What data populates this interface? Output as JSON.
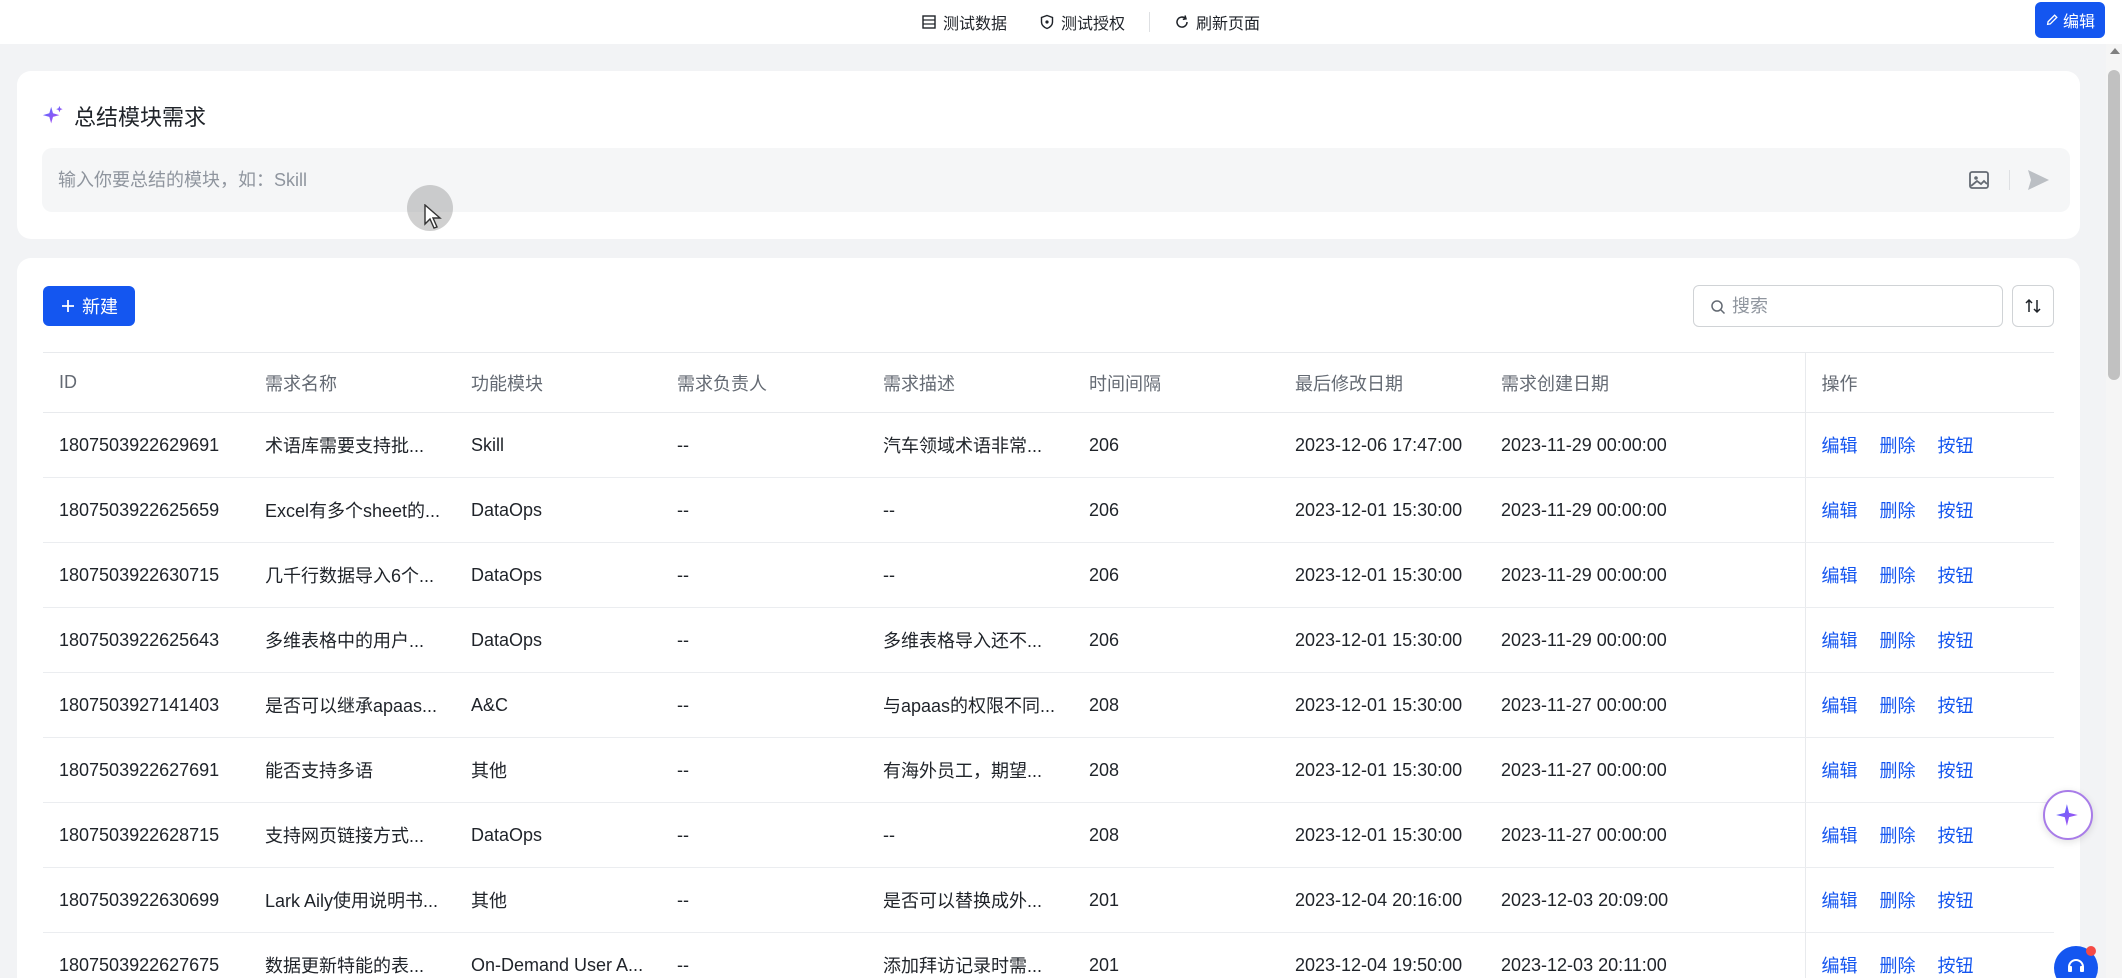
{
  "toolbar": {
    "test_data": "测试数据",
    "test_auth": "测试授权",
    "refresh": "刷新页面",
    "edit": "编辑"
  },
  "ai_summary": {
    "title": "总结模块需求",
    "placeholder": "输入你要总结的模块，如：Skill"
  },
  "table_toolbar": {
    "new_label": "新建",
    "search_placeholder": "搜索"
  },
  "columns": [
    "ID",
    "需求名称",
    "功能模块",
    "需求负责人",
    "需求描述",
    "时间间隔",
    "最后修改日期",
    "需求创建日期",
    "操作"
  ],
  "actions": {
    "edit": "编辑",
    "delete": "删除",
    "button": "按钮"
  },
  "rows": [
    {
      "id": "1807503922629691",
      "name": "术语库需要支持批...",
      "module": "Skill",
      "owner": "--",
      "desc": "汽车领域术语非常...",
      "interval": "206",
      "modified": "2023-12-06 17:47:00",
      "created": "2023-11-29 00:00:00"
    },
    {
      "id": "1807503922625659",
      "name": "Excel有多个sheet的...",
      "module": "DataOps",
      "owner": "--",
      "desc": "--",
      "interval": "206",
      "modified": "2023-12-01 15:30:00",
      "created": "2023-11-29 00:00:00"
    },
    {
      "id": "1807503922630715",
      "name": "几千行数据导入6个...",
      "module": "DataOps",
      "owner": "--",
      "desc": "--",
      "interval": "206",
      "modified": "2023-12-01 15:30:00",
      "created": "2023-11-29 00:00:00"
    },
    {
      "id": "1807503922625643",
      "name": "多维表格中的用户...",
      "module": "DataOps",
      "owner": "--",
      "desc": "多维表格导入还不...",
      "interval": "206",
      "modified": "2023-12-01 15:30:00",
      "created": "2023-11-29 00:00:00"
    },
    {
      "id": "1807503927141403",
      "name": "是否可以继承apaas...",
      "module": "A&C",
      "owner": "--",
      "desc": "与apaas的权限不同...",
      "interval": "208",
      "modified": "2023-12-01 15:30:00",
      "created": "2023-11-27 00:00:00"
    },
    {
      "id": "1807503922627691",
      "name": "能否支持多语",
      "module": "其他",
      "owner": "--",
      "desc": "有海外员工，期望...",
      "interval": "208",
      "modified": "2023-12-01 15:30:00",
      "created": "2023-11-27 00:00:00"
    },
    {
      "id": "1807503922628715",
      "name": "支持网页链接方式...",
      "module": "DataOps",
      "owner": "--",
      "desc": "--",
      "interval": "208",
      "modified": "2023-12-01 15:30:00",
      "created": "2023-11-27 00:00:00"
    },
    {
      "id": "1807503922630699",
      "name": "Lark Aily使用说明书...",
      "module": "其他",
      "owner": "--",
      "desc": "是否可以替换成外...",
      "interval": "201",
      "modified": "2023-12-04 20:16:00",
      "created": "2023-12-03 20:09:00"
    },
    {
      "id": "1807503922627675",
      "name": "数据更新特能的表...",
      "module": "On-Demand User A...",
      "owner": "--",
      "desc": "添加拜访记录时需...",
      "interval": "201",
      "modified": "2023-12-04 19:50:00",
      "created": "2023-12-03 20:11:00"
    }
  ]
}
